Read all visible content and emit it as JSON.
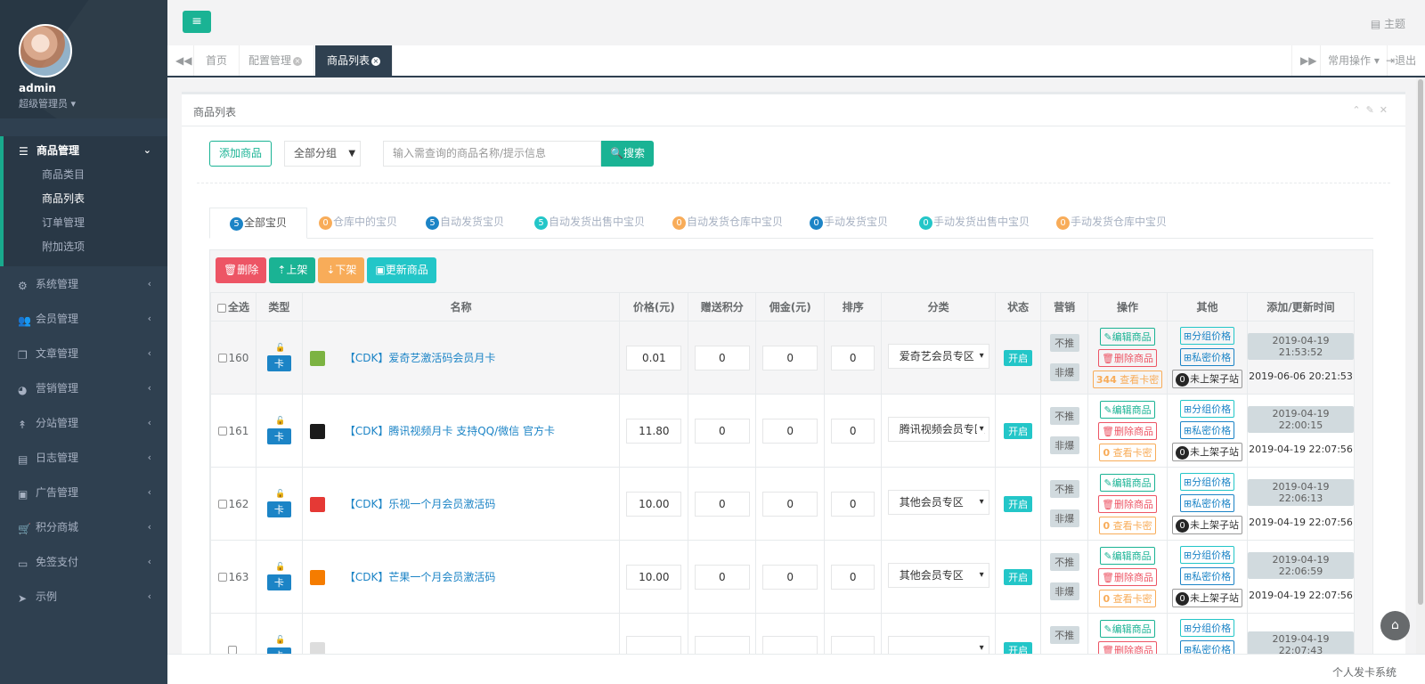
{
  "user": {
    "name": "admin",
    "role": "超级管理员"
  },
  "sidebar": {
    "active_group": "商品管理",
    "sub_items": [
      "商品类目",
      "商品列表",
      "订单管理",
      "附加选项"
    ],
    "items": [
      "系统管理",
      "会员管理",
      "文章管理",
      "营销管理",
      "分站管理",
      "日志管理",
      "广告管理",
      "积分商城",
      "免签支付",
      "示例"
    ]
  },
  "topbar": {
    "theme_label": "主题"
  },
  "tabs": {
    "items": [
      "首页",
      "配置管理",
      "商品列表"
    ],
    "common_ops": "常用操作",
    "logout": "退出"
  },
  "panel": {
    "title": "商品列表"
  },
  "toolbar": {
    "add_label": "添加商品",
    "category_select": "全部分组",
    "search_placeholder": "输入需查询的商品名称/提示信息",
    "search_label": "搜索"
  },
  "filter_tabs": [
    {
      "count": "5",
      "label": "全部宝贝"
    },
    {
      "count": "0",
      "label": "仓库中的宝贝"
    },
    {
      "count": "5",
      "label": "自动发货宝贝"
    },
    {
      "count": "5",
      "label": "自动发货出售中宝贝"
    },
    {
      "count": "0",
      "label": "自动发货仓库中宝贝"
    },
    {
      "count": "0",
      "label": "手动发货宝贝"
    },
    {
      "count": "0",
      "label": "手动发货出售中宝贝"
    },
    {
      "count": "0",
      "label": "手动发货仓库中宝贝"
    }
  ],
  "actions": {
    "delete": "删除",
    "up": "上架",
    "down": "下架",
    "refresh": "更新商品"
  },
  "table": {
    "headers": [
      "全选",
      "类型",
      "名称",
      "价格(元)",
      "赠送积分",
      "佣金(元)",
      "排序",
      "分类",
      "状态",
      "营销",
      "操作",
      "其他",
      "添加/更新时间"
    ],
    "type_label": "卡",
    "status_label": "开启",
    "marketing": [
      "不推",
      "非爆"
    ],
    "op_edit": "编辑商品",
    "op_delete": "删除商品",
    "op_view_suffix": "查看卡密",
    "other_group": "分组价格",
    "other_private": "私密价格",
    "other_site": "未上架子站",
    "rows": [
      {
        "id": "160",
        "name": "【CDK】爱奇艺激活码会员月卡",
        "price": "0.01",
        "points": "0",
        "commission": "0",
        "sort": "0",
        "category": "爱奇艺会员专区",
        "cards": "344",
        "added": "2019-04-19 21:53:52",
        "updated": "2019-06-06 20:21:53",
        "thumb_color": "#7cb342"
      },
      {
        "id": "161",
        "name": "【CDK】腾讯视频月卡 支持QQ/微信 官方卡",
        "price": "11.80",
        "points": "0",
        "commission": "0",
        "sort": "0",
        "category": "腾讯视频会员专区",
        "cards": "0",
        "added": "2019-04-19 22:00:15",
        "updated": "2019-04-19 22:07:56",
        "thumb_color": "#1b1b1b"
      },
      {
        "id": "162",
        "name": "【CDK】乐视一个月会员激活码",
        "price": "10.00",
        "points": "0",
        "commission": "0",
        "sort": "0",
        "category": "其他会员专区",
        "cards": "0",
        "added": "2019-04-19 22:06:13",
        "updated": "2019-04-19 22:07:56",
        "thumb_color": "#e53935"
      },
      {
        "id": "163",
        "name": "【CDK】芒果一个月会员激活码",
        "price": "10.00",
        "points": "0",
        "commission": "0",
        "sort": "0",
        "category": "其他会员专区",
        "cards": "0",
        "added": "2019-04-19 22:06:59",
        "updated": "2019-04-19 22:07:56",
        "thumb_color": "#f57c00"
      },
      {
        "id": "",
        "name": "",
        "price": "",
        "points": "",
        "commission": "",
        "sort": "",
        "category": "",
        "cards": "",
        "added": "2019-04-19 22:07:43",
        "updated": "",
        "thumb_color": "#dddddd"
      }
    ]
  },
  "footer": {
    "text": "个人发卡系统"
  }
}
